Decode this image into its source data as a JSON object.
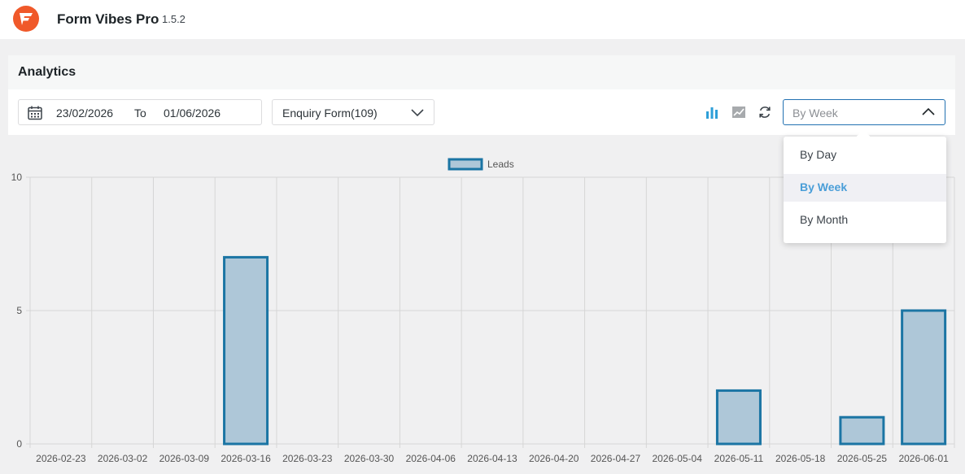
{
  "app": {
    "title": "Form Vibes Pro",
    "version": "1.5.2"
  },
  "page": {
    "title": "Analytics"
  },
  "filters": {
    "date_from": "23/02/2026",
    "to_label": "To",
    "date_to": "01/06/2026",
    "form_select": "Enquiry Form(109)",
    "period_value": "By Week"
  },
  "icons": {
    "bar_chart": "bar-chart-icon",
    "line_chart": "line-chart-icon",
    "refresh": "refresh-icon",
    "calendar": "calendar-icon"
  },
  "period_options": [
    {
      "label": "By Day",
      "selected": false
    },
    {
      "label": "By Week",
      "selected": true
    },
    {
      "label": "By Month",
      "selected": false
    }
  ],
  "colors": {
    "accent": "#2271b1",
    "bar_fill": "#aec7d8",
    "bar_stroke": "#1b75a4",
    "logo": "#f0592a",
    "selected_option": "#4a9ed8"
  },
  "chart_data": {
    "type": "bar",
    "categories": [
      "2026-02-23",
      "2026-03-02",
      "2026-03-09",
      "2026-03-16",
      "2026-03-23",
      "2026-03-30",
      "2026-04-06",
      "2026-04-13",
      "2026-04-20",
      "2026-04-27",
      "2026-05-04",
      "2026-05-11",
      "2026-05-18",
      "2026-05-25",
      "2026-06-01"
    ],
    "series": [
      {
        "name": "Leads",
        "values": [
          0,
          0,
          0,
          7,
          0,
          0,
          0,
          0,
          0,
          0,
          0,
          2,
          0,
          1,
          5
        ]
      }
    ],
    "ylim": [
      0,
      10
    ],
    "yticks": [
      0,
      5,
      10
    ],
    "grid": true,
    "legend": "top-center"
  }
}
